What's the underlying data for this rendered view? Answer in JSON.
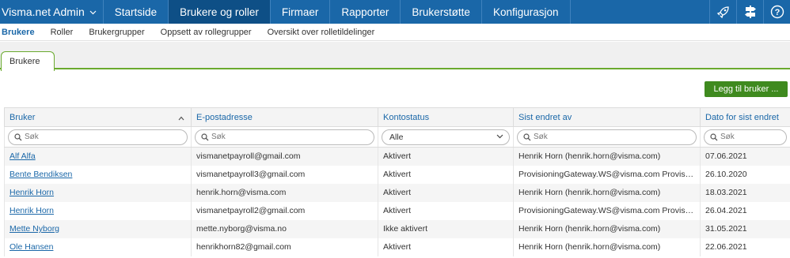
{
  "app": {
    "title": "Visma.net Admin"
  },
  "topnav": {
    "items": [
      "Startside",
      "Brukere og roller",
      "Firmaer",
      "Rapporter",
      "Brukerstøtte",
      "Konfigurasjon"
    ],
    "active_index": 1,
    "icons": [
      "rocket-icon",
      "signpost-icon",
      "help-icon"
    ]
  },
  "subnav": {
    "items": [
      "Brukere",
      "Roller",
      "Brukergrupper",
      "Oppsett av rollegrupper",
      "Oversikt over rolletildelinger"
    ],
    "active_index": 0
  },
  "tabs": {
    "items": [
      "Brukere"
    ]
  },
  "actions": {
    "add_user": "Legg til bruker ..."
  },
  "table": {
    "columns": [
      "Bruker",
      "E-postadresse",
      "Kontostatus",
      "Sist endret av",
      "Dato for sist endret"
    ],
    "filter": {
      "search_placeholder": "Søk",
      "status_value": "Alle"
    },
    "rows": [
      {
        "user": "Alf Alfa",
        "email": "vismanetpayroll@gmail.com",
        "status": "Aktivert",
        "changed_by": "Henrik Horn (henrik.horn@visma.com)",
        "date": "07.06.2021"
      },
      {
        "user": "Bente Bendiksen",
        "email": "vismanetpayroll3@gmail.com",
        "status": "Aktivert",
        "changed_by": "ProvisioningGateway.WS@visma.com Provisioning...",
        "date": "26.10.2020"
      },
      {
        "user": "Henrik Horn",
        "email": "henrik.horn@visma.com",
        "status": "Aktivert",
        "changed_by": "Henrik Horn (henrik.horn@visma.com)",
        "date": "18.03.2021"
      },
      {
        "user": "Henrik Horn",
        "email": "vismanetpayroll2@gmail.com",
        "status": "Aktivert",
        "changed_by": "ProvisioningGateway.WS@visma.com Provisioning...",
        "date": "26.04.2021"
      },
      {
        "user": "Mette Nyborg",
        "email": "mette.nyborg@visma.no",
        "status": "Ikke aktivert",
        "changed_by": "Henrik Horn (henrik.horn@visma.com)",
        "date": "31.05.2021"
      },
      {
        "user": "Ole Hansen",
        "email": "henrikhorn82@gmail.com",
        "status": "Aktivert",
        "changed_by": "Henrik Horn (henrik.horn@visma.com)",
        "date": "22.06.2021"
      }
    ]
  },
  "colors": {
    "nav_bg": "#1a67a8",
    "nav_active": "#0e4f86",
    "accent_green": "#3f8a1f",
    "tab_border": "#6aaa2e",
    "link": "#1a67a8"
  }
}
